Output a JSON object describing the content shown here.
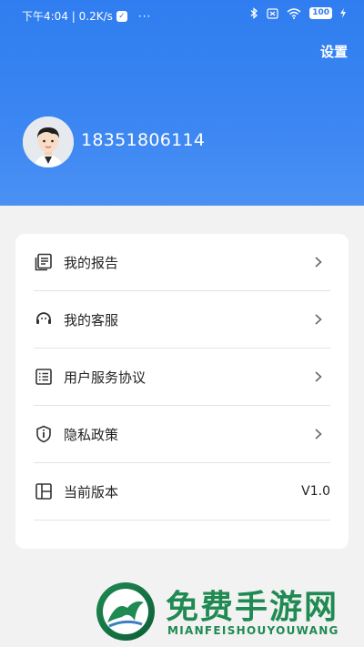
{
  "status_bar": {
    "time_info": "下午4:04 | 0.2K/s",
    "shield_glyph": "✓",
    "more_dots": "···",
    "battery": "100"
  },
  "header": {
    "settings_label": "设置",
    "phone_number": "18351806114"
  },
  "menu": {
    "items": [
      {
        "label": "我的报告",
        "icon": "report-icon"
      },
      {
        "label": "我的客服",
        "icon": "customer-service-icon"
      },
      {
        "label": "用户服务协议",
        "icon": "agreement-icon"
      },
      {
        "label": "隐私政策",
        "icon": "privacy-shield-icon"
      },
      {
        "label": "当前版本",
        "icon": "version-icon",
        "value": "V1.0"
      }
    ]
  },
  "watermark": {
    "title": "免费手游网",
    "subtitle": "MIANFEISHOUYOUWANG"
  },
  "colors": {
    "header_blue": "#3b86f2",
    "watermark_green": "#1f8a52"
  }
}
